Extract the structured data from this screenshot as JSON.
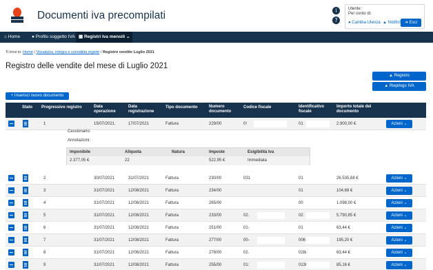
{
  "header": {
    "title": "Documenti iva precompilati",
    "user": {
      "label": "Utente:",
      "on_behalf": "Per conto di:",
      "change_user": "Cambia Utenza",
      "notifications": "Notifiche",
      "exit": "Esci"
    }
  },
  "nav": {
    "home": "Home",
    "profile": "Profilo soggetto IVA",
    "registers": "Registri Iva mensili"
  },
  "breadcrumb": {
    "prefix": "Ti trovi in:",
    "items": [
      "Home",
      "Visualizza, integra e convalida registri",
      "Registro vendite Luglio 2021"
    ]
  },
  "page_title": "Registro delle vendite del mese di Luglio 2021",
  "buttons": {
    "registro": "Registro",
    "riepilogo": "Riepilogo IVA",
    "inserisci": "Inserisci nuovo documento"
  },
  "table": {
    "headers": {
      "stato": "Stato",
      "progressivo": "Progressivo registro",
      "data_op": "Data operazione",
      "data_reg": "Data registrazione",
      "tipo": "Tipo documento",
      "numero": "Numero documento",
      "cf": "Codice fiscale",
      "id_fiscale": "Identificativo fiscale",
      "importo": "Importo totale del documento"
    },
    "action_label": "Azioni",
    "rows": [
      {
        "n": "1",
        "data_op": "15/07/2021",
        "data_reg": "17/07/2021",
        "tipo": "Fattura",
        "numero": "229/00",
        "cf": "0!",
        "idf": "01",
        "importo": "2.900,00 €"
      },
      {
        "n": "2",
        "data_op": "30/07/2021",
        "data_reg": "31/07/2021",
        "tipo": "Fattura",
        "numero": "230/00",
        "cf": "031",
        "idf": "01",
        "importo": "26.535,68 €"
      },
      {
        "n": "3",
        "data_op": "31/07/2021",
        "data_reg": "12/08/2021",
        "tipo": "Fattura",
        "numero": "234/00",
        "cf": "",
        "idf": "01",
        "importo": "104,68 €"
      },
      {
        "n": "4",
        "data_op": "31/07/2021",
        "data_reg": "12/08/2021",
        "tipo": "Fattura",
        "numero": "265/00",
        "cf": "",
        "idf": "00",
        "importo": "1.098,00 €"
      },
      {
        "n": "5",
        "data_op": "31/07/2021",
        "data_reg": "12/08/2021",
        "tipo": "Fattura",
        "numero": "233/00",
        "cf": "02.",
        "idf": "02",
        "importo": "5.790,85 €"
      },
      {
        "n": "6",
        "data_op": "31/07/2021",
        "data_reg": "12/08/2021",
        "tipo": "Fattura",
        "numero": "251/00",
        "cf": "01-",
        "idf": "01",
        "importo": "63,44 €"
      },
      {
        "n": "7",
        "data_op": "31/07/2021",
        "data_reg": "12/08/2021",
        "tipo": "Fattura",
        "numero": "277/00",
        "cf": "00-",
        "idf": "006",
        "importo": "195,20 €"
      },
      {
        "n": "8",
        "data_op": "31/07/2021",
        "data_reg": "12/08/2021",
        "tipo": "Fattura",
        "numero": "278/00",
        "cf": "02.",
        "idf": "028(",
        "importo": "63,44 €"
      },
      {
        "n": "9",
        "data_op": "31/07/2021",
        "data_reg": "12/08/2021",
        "tipo": "Fattura",
        "numero": "255/00",
        "cf": "01:",
        "idf": "0130",
        "importo": "85,16 €"
      }
    ]
  },
  "detail": {
    "cessionario": "Cessionario:",
    "annotazioni": "Annotazioni:",
    "headers": {
      "imponibile": "Imponibile",
      "aliquota": "Aliquota",
      "natura": "Natura",
      "imposte": "Imposte",
      "esigibilita": "Esigibilità Iva"
    },
    "values": {
      "imponibile": "2.377,05 €",
      "aliquota": "22",
      "natura": "",
      "imposte": "522,95 €",
      "esigibilita": "Immediata"
    }
  }
}
